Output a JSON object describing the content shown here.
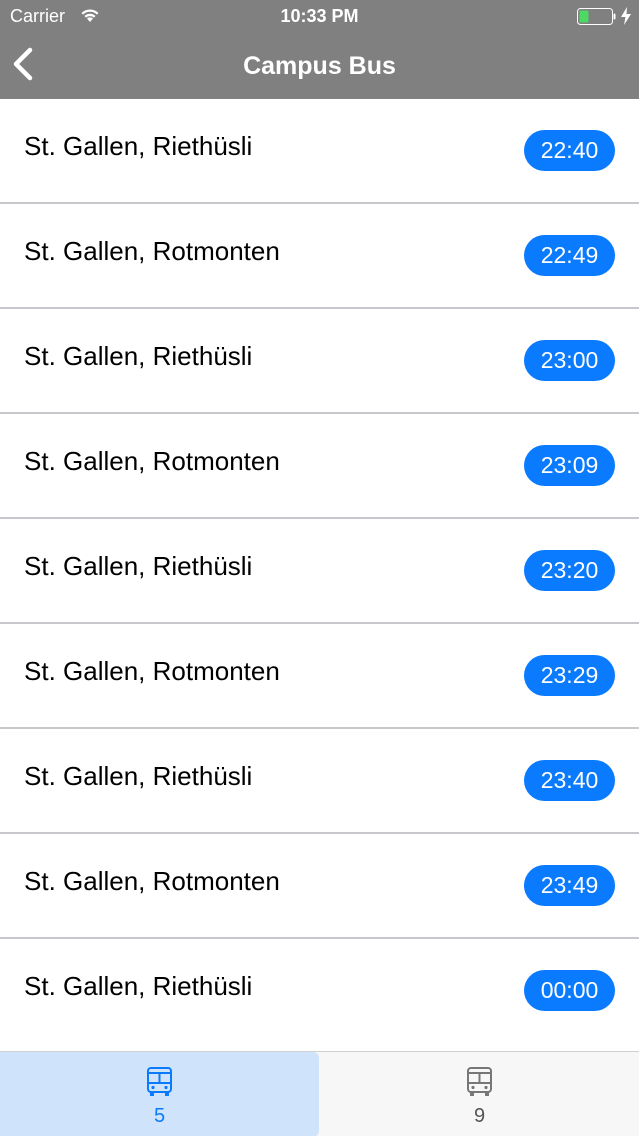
{
  "status_bar": {
    "carrier": "Carrier",
    "time": "10:33 PM",
    "wifi_icon": "wifi-icon",
    "battery_icon": "battery-icon",
    "charging_icon": "bolt-icon"
  },
  "nav": {
    "title": "Campus Bus",
    "back_icon": "chevron-left-icon"
  },
  "departures": [
    {
      "destination": "St. Gallen, Riethüsli",
      "time": "22:40"
    },
    {
      "destination": "St. Gallen, Rotmonten",
      "time": "22:49"
    },
    {
      "destination": "St. Gallen, Riethüsli",
      "time": "23:00"
    },
    {
      "destination": "St. Gallen, Rotmonten",
      "time": "23:09"
    },
    {
      "destination": "St. Gallen, Riethüsli",
      "time": "23:20"
    },
    {
      "destination": "St. Gallen, Rotmonten",
      "time": "23:29"
    },
    {
      "destination": "St. Gallen, Riethüsli",
      "time": "23:40"
    },
    {
      "destination": "St. Gallen, Rotmonten",
      "time": "23:49"
    },
    {
      "destination": "St. Gallen, Riethüsli",
      "time": "00:00"
    }
  ],
  "tabs": [
    {
      "label": "5",
      "icon": "bus-icon",
      "selected": true
    },
    {
      "label": "9",
      "icon": "bus-icon",
      "selected": false
    }
  ],
  "colors": {
    "accent": "#0a7aff",
    "nav_background": "#808080",
    "tab_selected_background": "#cfe3fa",
    "battery_level": "#4cd964"
  }
}
